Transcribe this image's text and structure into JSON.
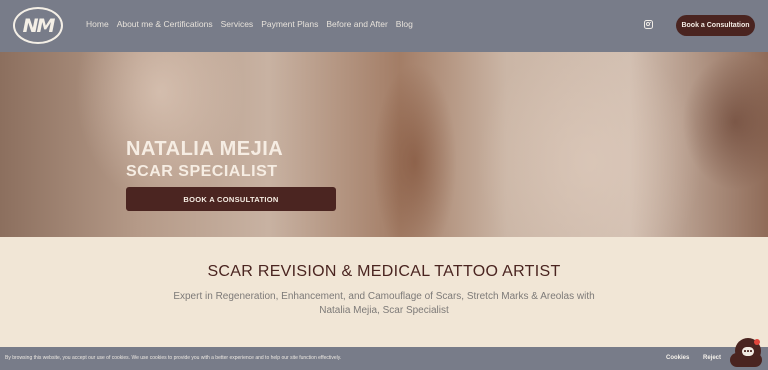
{
  "header": {
    "logo_text": "NM",
    "nav": [
      {
        "label": "Home"
      },
      {
        "label": "About me & Certifications"
      },
      {
        "label": "Services"
      },
      {
        "label": "Payment Plans"
      },
      {
        "label": "Before and After"
      },
      {
        "label": "Blog"
      }
    ],
    "social_icon": "instagram-icon",
    "cta_label": "Book a Consultation"
  },
  "hero": {
    "title": "NATALIA MEJIA",
    "subtitle": "SCAR SPECIALIST",
    "button_label": "BOOK A CONSULTATION"
  },
  "content": {
    "title": "SCAR REVISION & MEDICAL TATTOO ARTIST",
    "description": "Expert in Regeneration, Enhancement, and Camouflage of Scars, Stretch Marks & Areolas with Natalia Mejia, Scar Specialist"
  },
  "cookie_bar": {
    "text": "By browsing this website, you accept our use of cookies. We use cookies to provide you with a better experience and to help our site function effectively.",
    "cookies_label": "Cookies",
    "reject_label": "Reject",
    "chat_icon": "chat-icon"
  },
  "colors": {
    "header_bg": "#787c89",
    "brand_dark": "#4a2420",
    "content_bg": "#f1e6d6"
  }
}
